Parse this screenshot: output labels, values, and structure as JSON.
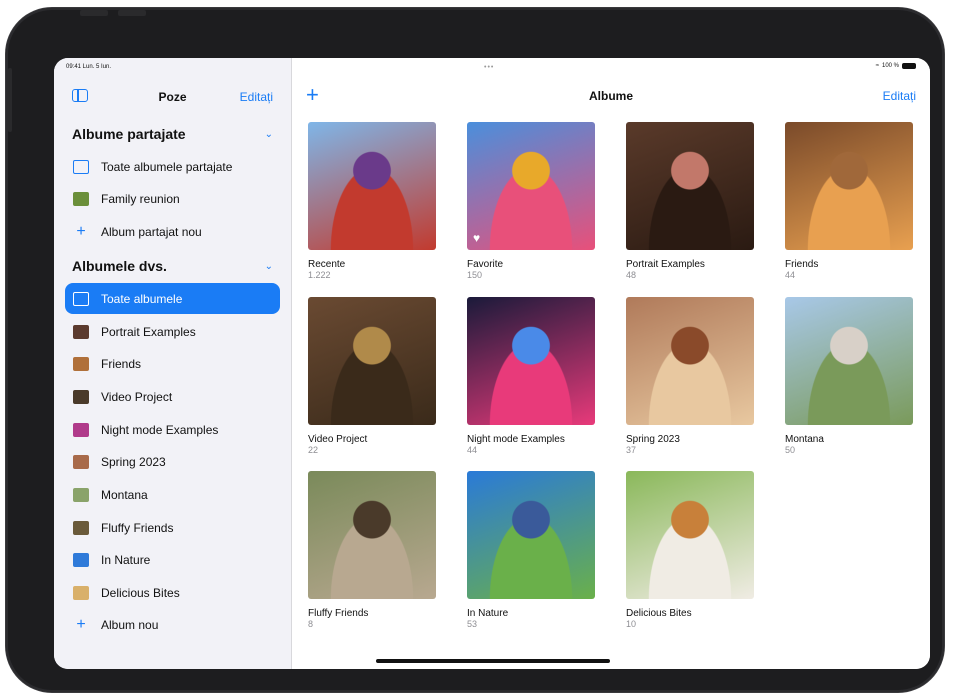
{
  "status_bar": {
    "time": "09:41 Lun. 5 Iun.",
    "dots": "•••",
    "battery": "100 %"
  },
  "sidebar": {
    "title": "Poze",
    "edit_label": "Editați",
    "sections": [
      {
        "title": "Albume partajate",
        "items": [
          {
            "label": "Toate albumele partajate",
            "icon": "shared-albums-icon"
          },
          {
            "label": "Family reunion",
            "icon": "family-reunion-thumb",
            "color": "#6b8f3a"
          },
          {
            "label": "Album partajat nou",
            "icon": "plus-icon"
          }
        ]
      },
      {
        "title": "Albumele dvs.",
        "items": [
          {
            "label": "Toate albumele",
            "icon": "albums-icon",
            "selected": true
          },
          {
            "label": "Portrait Examples",
            "icon": "portrait-thumb",
            "color": "#5b3a2e"
          },
          {
            "label": "Friends",
            "icon": "friends-thumb",
            "color": "#b0703a"
          },
          {
            "label": "Video Project",
            "icon": "video-thumb",
            "color": "#4a3a2a"
          },
          {
            "label": "Night mode Examples",
            "icon": "night-thumb",
            "color": "#b03a8a"
          },
          {
            "label": "Spring 2023",
            "icon": "spring-thumb",
            "color": "#a86a4a"
          },
          {
            "label": "Montana",
            "icon": "montana-thumb",
            "color": "#8aa36a"
          },
          {
            "label": "Fluffy Friends",
            "icon": "fluffy-thumb",
            "color": "#6a5a3a"
          },
          {
            "label": "In Nature",
            "icon": "nature-thumb",
            "color": "#2f7ad9"
          },
          {
            "label": "Delicious Bites",
            "icon": "bites-thumb",
            "color": "#d9b06a"
          },
          {
            "label": "Album nou",
            "icon": "plus-icon"
          }
        ]
      }
    ]
  },
  "main": {
    "title": "Albume",
    "add_label": "+",
    "edit_label": "Editați",
    "albums": [
      {
        "name": "Recente",
        "count": "1.222",
        "colors": [
          "#7fb6e8",
          "#c23a2e",
          "#6a3a8a"
        ]
      },
      {
        "name": "Favorite",
        "count": "150",
        "colors": [
          "#4a8fdc",
          "#e8507a",
          "#e8a92a"
        ],
        "favorite": true
      },
      {
        "name": "Portrait Examples",
        "count": "48",
        "colors": [
          "#5a3a2a",
          "#2a1a12",
          "#c2786a"
        ]
      },
      {
        "name": "Friends",
        "count": "44",
        "colors": [
          "#7a4a2a",
          "#e8a050",
          "#a0683a"
        ]
      },
      {
        "name": "Video Project",
        "count": "22",
        "colors": [
          "#6a4a32",
          "#3a2a1a",
          "#b08a4a"
        ]
      },
      {
        "name": "Night mode Examples",
        "count": "44",
        "colors": [
          "#1a1a3a",
          "#e83a7a",
          "#4a8ae8"
        ]
      },
      {
        "name": "Spring 2023",
        "count": "37",
        "colors": [
          "#b07a5a",
          "#e8c8a0",
          "#8a4a2a"
        ]
      },
      {
        "name": "Montana",
        "count": "50",
        "colors": [
          "#a8c8e8",
          "#7a9a5a",
          "#d8d0c8"
        ]
      },
      {
        "name": "Fluffy Friends",
        "count": "8",
        "colors": [
          "#7a8a5a",
          "#b8a890",
          "#4a3a2a"
        ]
      },
      {
        "name": "In Nature",
        "count": "53",
        "colors": [
          "#2a7ad8",
          "#6ab04a",
          "#3a5a9a"
        ]
      },
      {
        "name": "Delicious Bites",
        "count": "10",
        "colors": [
          "#8ab85a",
          "#f0ece4",
          "#c8803a"
        ]
      }
    ]
  }
}
